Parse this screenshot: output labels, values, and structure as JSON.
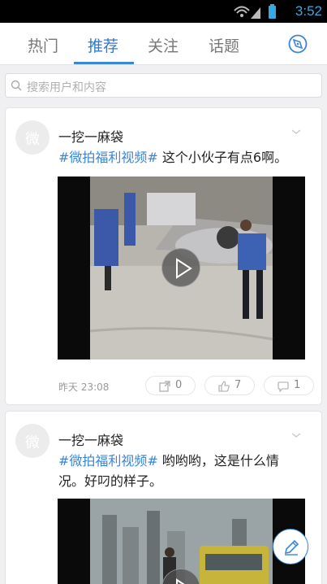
{
  "statusbar": {
    "time": "3:52"
  },
  "tabs": [
    {
      "label": "热门"
    },
    {
      "label": "推荐"
    },
    {
      "label": "关注"
    },
    {
      "label": "话题"
    }
  ],
  "search": {
    "placeholder": "搜索用户和内容"
  },
  "posts": [
    {
      "avatar_text": "微",
      "username": "一挖一麻袋",
      "topic": "#微拍福利视频#",
      "text": " 这个小伙子有点6啊。",
      "time": "昨天  23:08",
      "reposts": "0",
      "likes": "7",
      "comments": "1"
    },
    {
      "avatar_text": "微",
      "username": "一挖一麻袋",
      "topic": "#微拍福利视频#",
      "text": " 哟哟哟，这是什么情况。好叼的样子。"
    }
  ],
  "colors": {
    "accent": "#3a86d6",
    "status_time": "#38a8e0"
  }
}
